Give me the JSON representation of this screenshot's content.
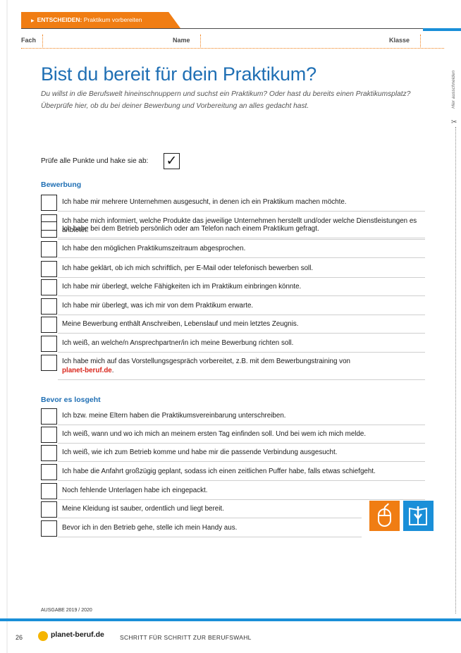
{
  "header": {
    "section": "ENTSCHEIDEN:",
    "topic": "Praktikum vorbereiten"
  },
  "fields": {
    "fach": "Fach",
    "name": "Name",
    "klasse": "Klasse"
  },
  "side": {
    "cut_label": "Hier ausschneiden"
  },
  "main": {
    "title": "Bist du bereit für dein Praktikum?",
    "intro": "Du willst in die Berufswelt hineinschnuppern und suchst ein Praktikum? Oder hast du bereits einen Praktikumsplatz? Überprüfe hier, ob du bei deiner Bewerbung und Vorbereitung an alles gedacht hast.",
    "check_hint": "Prüfe alle Punkte und hake sie ab:",
    "check_mark": "✓"
  },
  "bewerbung": {
    "heading": "Bewerbung",
    "items": [
      "Ich habe mir mehrere Unternehmen ausgesucht, in denen ich ein Praktikum machen möchte.",
      "Ich habe mich informiert, welche Produkte das jeweilige Unternehmen herstellt und/oder welche Dienstleistungen es anbietet.",
      "Ich habe bei dem Betrieb persönlich oder am Telefon nach einem Praktikum gefragt.",
      "Ich habe den möglichen Praktikumszeitraum abgesprochen.",
      "Ich habe geklärt, ob ich mich schriftlich, per E-Mail oder telefonisch bewerben soll.",
      "Ich habe mir überlegt, welche Fähigkeiten ich im Praktikum einbringen könnte.",
      "Ich habe mir überlegt, was ich mir von dem Praktikum erwarte.",
      "Meine Bewerbung enthält Anschreiben, Lebenslauf und mein letztes Zeugnis.",
      "Ich weiß, an welche/n Ansprechpartner/in ich meine Bewerbung richten soll."
    ],
    "last_item_text": "Ich habe mich auf das Vorstellungsgespräch vorbereitet, z.B. mit dem Bewerbungstraining von",
    "last_item_link": "planet-beruf.de",
    "last_item_end": "."
  },
  "bevor": {
    "heading": "Bevor es losgeht",
    "items": [
      "Ich bzw. meine Eltern haben die Praktikumsvereinbarung unterschreiben.",
      "Ich weiß, wann und wo ich mich an meinem ersten Tag einfinden soll. Und bei wem ich mich melde.",
      "Ich weiß, wie ich zum Betrieb komme und habe mir die passende Verbindung ausgesucht.",
      "Ich habe die Anfahrt großzügig geplant, sodass ich einen zeitlichen Puffer habe, falls etwas schiefgeht.",
      "Noch fehlende Unterlagen habe ich eingepackt.",
      "Meine Kleidung ist sauber, ordentlich und liegt bereit.",
      "Bevor ich in den Betrieb gehe, stelle ich mein Handy aus."
    ]
  },
  "icons": [
    "mouse-icon",
    "book-download-icon"
  ],
  "colors": {
    "orange": "#f07d13",
    "blue": "#1f6fb4",
    "accent_blue": "#1a8fd8",
    "link_red": "#d9261c"
  },
  "footer": {
    "ausgabe": "AUSGABE 2019 / 2020",
    "page_number": "26",
    "logo": "planet-beruf.de",
    "claim": "SCHRITT FÜR SCHRITT ZUR BERUFSWAHL"
  }
}
